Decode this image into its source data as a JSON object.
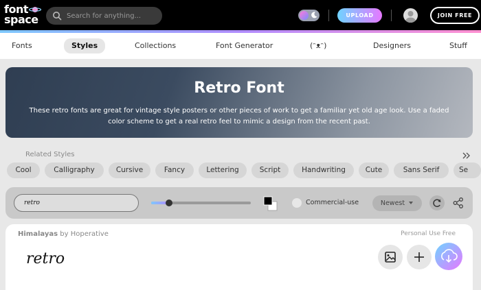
{
  "header": {
    "logo_line1": "font",
    "logo_line2": "space",
    "search_placeholder": "Search for anything...",
    "upload_label": "UPLOAD",
    "join_label": "JOIN FREE"
  },
  "nav": {
    "items": [
      {
        "label": "Fonts"
      },
      {
        "label": "Styles"
      },
      {
        "label": "Collections"
      },
      {
        "label": "Font Generator"
      },
      {
        "label": "(ᵔᴥᵔ)"
      },
      {
        "label": "Designers"
      },
      {
        "label": "Stuff"
      }
    ],
    "active": "Styles"
  },
  "hero": {
    "title": "Retro Font",
    "description": "These retro fonts are great for vintage style posters or other pieces of work to get a familiar yet old age look. Use a faded color scheme to get a real retro feel to mimic a design from the recent past."
  },
  "related": {
    "label": "Related Styles",
    "chips": [
      "Cool",
      "Calligraphy",
      "Cursive",
      "Fancy",
      "Lettering",
      "Script",
      "Handwriting",
      "Cute",
      "Sans Serif",
      "Se"
    ]
  },
  "filters": {
    "preview_text": "retro",
    "size_level": 0.18,
    "foreground_color": "#000000",
    "background_color": "#ffffff",
    "commercial_label": "Commercial-use",
    "sort_label": "Newest"
  },
  "font_card": {
    "font_name": "Himalayas",
    "by_label": "by",
    "designer": "Hoperative",
    "license": "Personal Use Free",
    "preview_text": "retro"
  },
  "colors": {
    "accent_gradient_start": "#6fd3ff",
    "accent_gradient_end": "#e678ff"
  }
}
